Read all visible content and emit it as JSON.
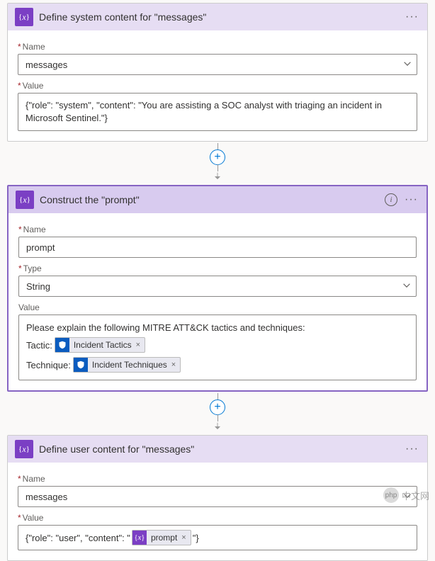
{
  "card1": {
    "title": "Define system content for \"messages\"",
    "nameLabel": "Name",
    "nameValue": "messages",
    "valueLabel": "Value",
    "valueText": "{\"role\": \"system\", \"content\": \"You are assisting a SOC analyst with triaging an incident in Microsoft Sentinel.\"}"
  },
  "card2": {
    "title": "Construct the \"prompt\"",
    "nameLabel": "Name",
    "nameValue": "prompt",
    "typeLabel": "Type",
    "typeValue": "String",
    "valueLabel": "Value",
    "valueIntro": "Please explain the following MITRE ATT&CK tactics and techniques:",
    "tacticLabel": "Tactic:",
    "tacticToken": "Incident Tactics",
    "techniqueLabel": "Technique:",
    "techniqueToken": "Incident Techniques"
  },
  "card3": {
    "title": "Define user content for \"messages\"",
    "nameLabel": "Name",
    "nameValue": "messages",
    "valueLabel": "Value",
    "valuePrefix": "{\"role\": \"user\", \"content\": \"",
    "promptToken": "prompt",
    "valueSuffix": "\"}"
  },
  "watermark": "中文网"
}
